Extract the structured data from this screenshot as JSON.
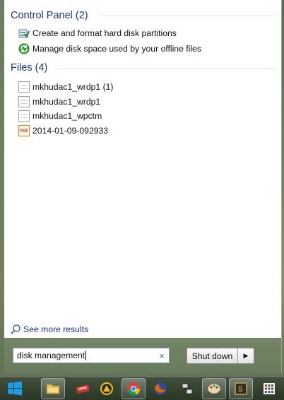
{
  "groups": [
    {
      "header": "Control Panel (2)",
      "items": [
        {
          "label": "Create and format hard disk partitions",
          "icon": "disk-management-icon"
        },
        {
          "label": "Manage disk space used by your offline files",
          "icon": "sync-center-icon"
        }
      ]
    },
    {
      "header": "Files (4)",
      "items": [
        {
          "label": "mkhudac1_wrdp1 (1)",
          "icon": "document-icon"
        },
        {
          "label": "mkhudac1_wrdp1",
          "icon": "document-icon"
        },
        {
          "label": "mkhudac1_wpctm",
          "icon": "document-icon"
        },
        {
          "label": "2014-01-09-092933",
          "icon": "pdf-icon",
          "icon_text": "PDF"
        }
      ]
    }
  ],
  "see_more": "See more results",
  "search": {
    "value": "disk management",
    "clear": "×"
  },
  "shutdown": {
    "label": "Shut down",
    "arrow": "▶"
  },
  "colors": {
    "header": "#1e3287",
    "win_blue": "#1a9ee8",
    "chrome_red": "#db4437",
    "chrome_yellow": "#f4c20d",
    "chrome_green": "#0f9d58"
  },
  "taskbar": [
    "windows-start-icon",
    "file-explorer-icon",
    "red-app-icon",
    "yellow-triangle-app-icon",
    "chrome-icon",
    "firefox-icon",
    "network-app-icon",
    "paint-icon",
    "terminal-icon",
    "grid-app-icon"
  ]
}
